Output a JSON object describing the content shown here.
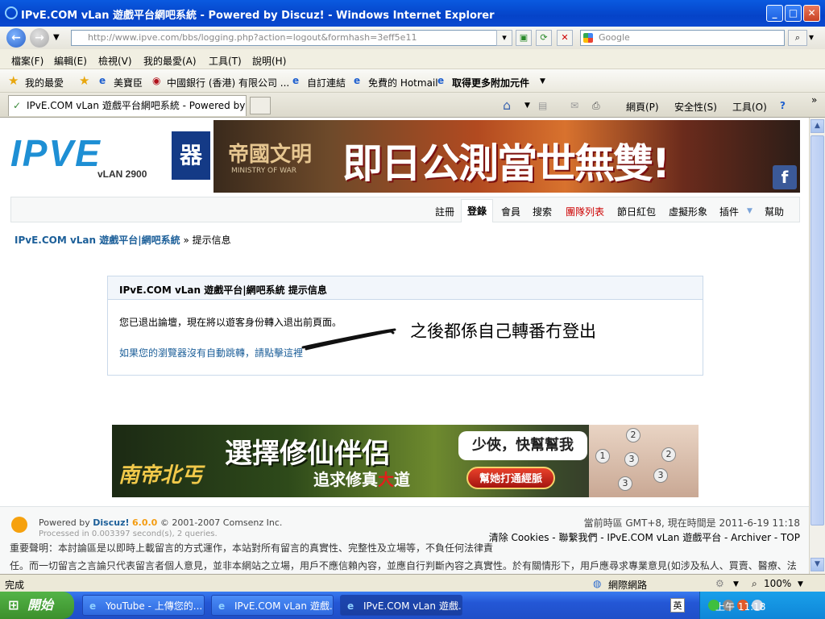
{
  "window": {
    "title": "IPvE.COM vLan 遊戲平台網吧系統 - Powered by Discuz! - Windows Internet Explorer"
  },
  "addressbar": {
    "url": "http://www.ipve.com/bbs/logging.php?action=logout&formhash=3eff5e11",
    "search_placeholder": "Google"
  },
  "menu": [
    "檔案(F)",
    "編輯(E)",
    "檢視(V)",
    "我的最愛(A)",
    "工具(T)",
    "說明(H)"
  ],
  "favorites": {
    "label": "我的最愛",
    "items": [
      "美寶臣",
      "中國銀行 (香港) 有限公司 ...",
      "自訂連結",
      "免費的 Hotmail",
      "取得更多附加元件"
    ]
  },
  "tabs": {
    "active_tab": "IPvE.COM vLan 遊戲平台網吧系統 - Powered by Di..."
  },
  "command_bar": {
    "page": "網頁(P)",
    "safety": "安全性(S)",
    "tools": "工具(O)"
  },
  "banner": {
    "logo_text": "IPVE",
    "logo_sub": "vLAN 2900",
    "logo_zh": "器",
    "ad_game": "帝國文明",
    "ad_game_sub": "MINISTRY OF WAR",
    "ad_headline": "即日公測當世無雙!"
  },
  "navbar": {
    "items": [
      "註冊",
      "登錄",
      "會員",
      "搜索",
      "團隊列表",
      "節日紅包",
      "虛擬形象",
      "插件",
      "幫助"
    ]
  },
  "breadcrumb": {
    "site": "IPvE.COM vLan 遊戲平台|網吧系統",
    "separator": "»",
    "current": "提示信息"
  },
  "message": {
    "header": "IPvE.COM vLan 遊戲平台|網吧系統 提示信息",
    "line1": "您已退出論壇，現在將以遊客身份轉入退出前頁面。",
    "link": "如果您的瀏覽器沒有自動跳轉，請點擊這裡",
    "annotation": "之後都係自己轉番冇登出"
  },
  "ad2": {
    "game": "南帝北丐",
    "headline": "選擇修仙伴侶",
    "sub_prefix": "追求修真",
    "sub_highlight": "大",
    "sub_suffix": "道",
    "bubble": "少俠，快幫幫我",
    "button": "幫她打通經脈",
    "dots": [
      "1",
      "2",
      "2",
      "3",
      "3",
      "3"
    ]
  },
  "footer": {
    "powered_prefix": "Powered by",
    "powered_brand": "Discuz!",
    "powered_version": "6.0.0",
    "copyright": "© 2001-2007 Comsenz Inc.",
    "processed": "Processed in 0.003397 second(s), 2 queries.",
    "time": "當前時區 GMT+8, 現在時間是 2011-6-19 11:18",
    "links": "清除 Cookies - 聯繫我們 - IPvE.COM vLan 遊戲平台 - Archiver - TOP",
    "disclaimer1": "重要聲明：本討論區是以即時上載留言的方式運作，本站對所有留言的真實性、完整性及立場等，不負任何法律責",
    "disclaimer2": "任。而一切留言之言論只代表留言者個人意見，並非本網站之立場，用戶不應信賴內容，並應自行判斷內容之真實性。於有關情形下，用戶應尋求專業意見(如涉及私人、買賣、醫療、法"
  },
  "statusbar": {
    "status": "完成",
    "zone": "網際網路",
    "zoom": "100%"
  },
  "taskbar": {
    "start": "開始",
    "tasks": [
      "YouTube - 上傳您的...",
      "IPvE.COM vLan 遊戲...",
      "IPvE.COM vLan 遊戲..."
    ],
    "clock": "上午 11:18"
  }
}
